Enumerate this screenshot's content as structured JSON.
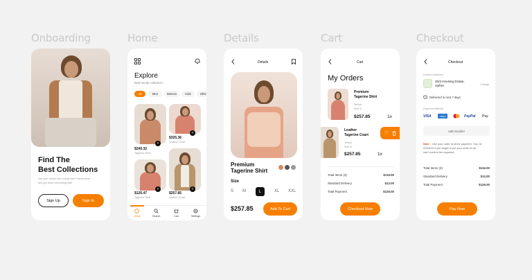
{
  "columns": [
    "Onboarding",
    "Home",
    "Details",
    "Cart",
    "Checkout"
  ],
  "onboarding": {
    "title_line1": "Find The",
    "title_line2": "Best Collections",
    "desc_line1": "Get your dream item easily with FashionHub",
    "desc_line2": "and get other interesting offer",
    "signup": "Sign Up",
    "signin": "Sign In"
  },
  "home": {
    "title": "Explore",
    "subtitle": "Best trendy collection!",
    "chips": [
      "All",
      "Men",
      "Women",
      "Kids",
      "Other"
    ],
    "products": [
      {
        "price": "$240.32",
        "name": "Tagerine Shirt"
      },
      {
        "price": "$325.36",
        "name": "Leather Coart"
      },
      {
        "price": "$126.47",
        "name": "Tagerine Shirt"
      },
      {
        "price": "$257.85",
        "name": "Leather Coart"
      }
    ],
    "nav": [
      "Home",
      "Search",
      "Cart",
      "Settings"
    ]
  },
  "details": {
    "header": "Details",
    "name_line1": "Premium",
    "name_line2": "Tagerine Shirt",
    "size_label": "Size",
    "sizes": [
      "S",
      "M",
      "L",
      "XL",
      "XXL"
    ],
    "selected_size": "L",
    "price": "$257.85",
    "add_to_cart": "Add To Cart"
  },
  "cart": {
    "header": "Cart",
    "title": "My Orders",
    "items": [
      {
        "name_line1": "Premium",
        "name_line2": "Tagerine Shirt",
        "color": "Yellow",
        "size": "Size 8",
        "price": "$257.85",
        "qty": "1x"
      },
      {
        "name_line1": "Leather",
        "name_line2": "Tagerine Coart",
        "color": "Yellow",
        "size": "Size 8",
        "price": "$257.85",
        "qty": "1x"
      }
    ],
    "summary": [
      {
        "label": "Total Items (3)",
        "value": "$116.00"
      },
      {
        "label": "Standard Delivery",
        "value": "$12.00"
      },
      {
        "label": "Total Payment",
        "value": "$126.00"
      }
    ],
    "checkout": "Checkout Now"
  },
  "checkout": {
    "header": "Checkout",
    "delivery_label": "Delivery Address",
    "address_line1": "25/3 Housing Estate,",
    "address_line2": "Sylhet",
    "change": "Change",
    "delivered": "Delivered in next 7 days",
    "payment_label": "Payment Method",
    "payments": [
      "VISA",
      "AMEX",
      "MC",
      "PayPal",
      "Pay"
    ],
    "voucher": "Add Voucher",
    "note_bold": "Note :",
    "note_line1": "Use your order id at the payment. Your Id",
    "note_line2": "#154619 if you forget to put your order id we",
    "note_line3": "can't confirm the payment.",
    "summary": [
      {
        "label": "Total Items (3)",
        "value": "$116.00"
      },
      {
        "label": "Standard Delivery",
        "value": "$12.00"
      },
      {
        "label": "Total Payment",
        "value": "$126.00"
      }
    ],
    "pay": "Pay Now"
  },
  "colors": {
    "accent": "#f77f00",
    "background": "#f2f2f2",
    "dark": "#111111"
  }
}
